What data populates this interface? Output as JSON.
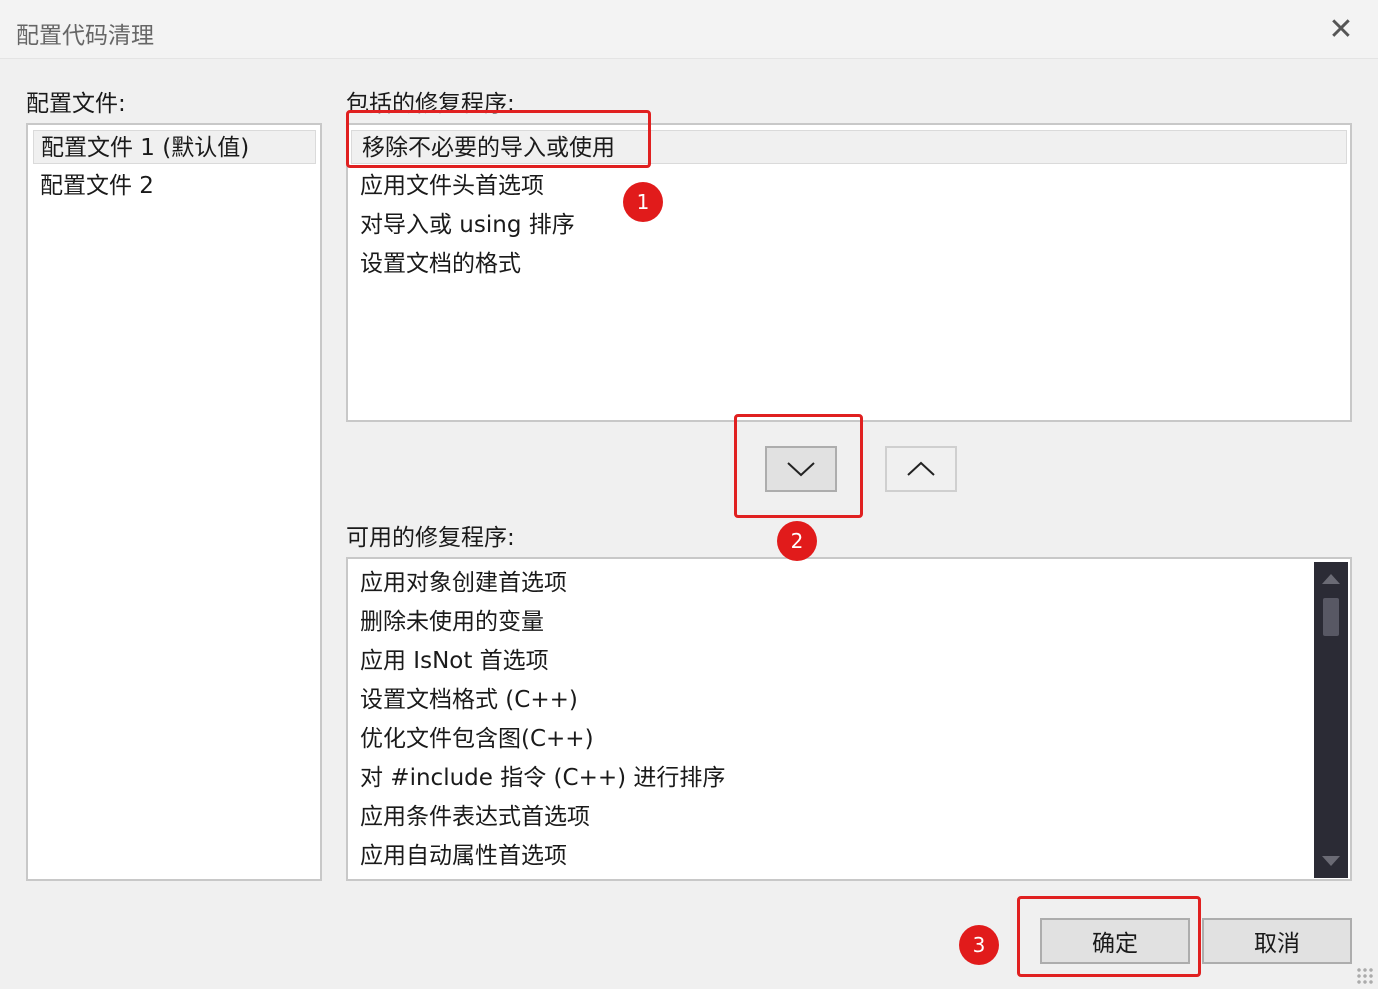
{
  "window": {
    "title": "配置代码清理",
    "close_icon": "✕"
  },
  "profiles": {
    "label": "配置文件:",
    "items": [
      "配置文件 1 (默认值)",
      "配置文件 2"
    ],
    "selected_index": 0
  },
  "included": {
    "label": "包括的修复程序:",
    "items": [
      "移除不必要的导入或使用",
      "应用文件头首选项",
      "对导入或 using 排序",
      "设置文档的格式"
    ],
    "selected_index": 0
  },
  "move_buttons": {
    "down_icon": "chevron-down-icon",
    "up_icon": "chevron-up-icon"
  },
  "available": {
    "label": "可用的修复程序:",
    "items": [
      "应用对象创建首选项",
      "删除未使用的变量",
      "应用 IsNot 首选项",
      "设置文档格式 (C++)",
      "优化文件包含图(C++)",
      "对 #include 指令 (C++) 进行排序",
      "应用条件表达式首选项",
      "应用自动属性首选项"
    ]
  },
  "footer": {
    "ok_label": "确定",
    "cancel_label": "取消"
  },
  "annotations": {
    "badges": [
      "1",
      "2",
      "3"
    ],
    "highlight_color": "#e02020"
  }
}
